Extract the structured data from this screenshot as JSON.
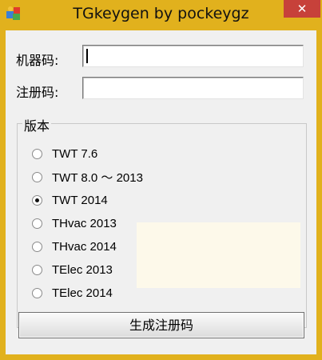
{
  "window": {
    "title": "TGkeygen by pockeygz",
    "close_glyph": "✕"
  },
  "icons": {
    "app": "app-icon",
    "close": "close-icon"
  },
  "form": {
    "machine_code_label": "机器码:",
    "machine_code_value": "",
    "reg_code_label": "注册码:",
    "reg_code_value": ""
  },
  "version_group": {
    "title": "版本",
    "options": [
      {
        "label": "TWT 7.6",
        "checked": false
      },
      {
        "label": "TWT 8.0 ～ 2013",
        "checked": false
      },
      {
        "label": "TWT 2014",
        "checked": true
      },
      {
        "label": "THvac 2013",
        "checked": false
      },
      {
        "label": "THvac 2014",
        "checked": false
      },
      {
        "label": "TElec 2013",
        "checked": false
      },
      {
        "label": "TElec 2014",
        "checked": false
      }
    ]
  },
  "generate_button": "生成注册码",
  "colors": {
    "titlebar": "#e1b11d",
    "close": "#c7413a",
    "panel": "#f0f0f0"
  }
}
